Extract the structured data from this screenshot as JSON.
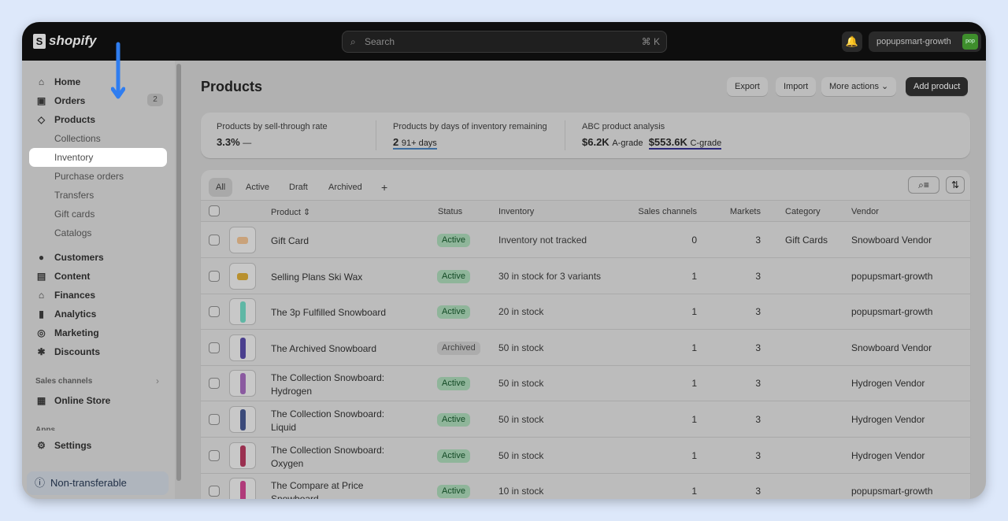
{
  "topbar": {
    "logo": "shopify",
    "search_placeholder": "Search",
    "search_shortcut": "⌘ K",
    "store_name": "popupsmart-growth",
    "avatar": "pop"
  },
  "sidebar": {
    "items": [
      {
        "label": "Home",
        "icon": "home-icon"
      },
      {
        "label": "Orders",
        "icon": "inbox-icon",
        "badge": "2"
      },
      {
        "label": "Products",
        "icon": "tag-icon"
      }
    ],
    "product_sub": [
      "Collections",
      "Inventory",
      "Purchase orders",
      "Transfers",
      "Gift cards",
      "Catalogs"
    ],
    "items2": [
      {
        "label": "Customers",
        "icon": "person-icon"
      },
      {
        "label": "Content",
        "icon": "content-icon"
      },
      {
        "label": "Finances",
        "icon": "bank-icon"
      },
      {
        "label": "Analytics",
        "icon": "chart-icon"
      },
      {
        "label": "Marketing",
        "icon": "target-icon"
      },
      {
        "label": "Discounts",
        "icon": "discount-icon"
      }
    ],
    "sales_channels_label": "Sales channels",
    "online_store": "Online Store",
    "apps_label": "Apps",
    "settings": "Settings",
    "non_transferable": "Non-transferable"
  },
  "page": {
    "title": "Products",
    "export": "Export",
    "import": "Import",
    "more_actions": "More actions",
    "add_product": "Add product"
  },
  "metrics": {
    "m1": {
      "title": "Products by sell-through rate",
      "value": "3.3%",
      "trend": "—"
    },
    "m2": {
      "title": "Products by days of inventory remaining",
      "value": "2",
      "suffix": "91+ days"
    },
    "m3": {
      "title": "ABC product analysis",
      "a_value": "$6.2K",
      "a_label": "A-grade",
      "c_value": "$553.6K",
      "c_label": "C-grade"
    }
  },
  "tabs": [
    "All",
    "Active",
    "Draft",
    "Archived",
    "+"
  ],
  "columns": {
    "product": "Product",
    "status": "Status",
    "inventory": "Inventory",
    "sales_channels": "Sales channels",
    "markets": "Markets",
    "category": "Category",
    "vendor": "Vendor"
  },
  "rows": [
    {
      "name": "Gift Card",
      "name2": "",
      "status": "Active",
      "inventory": "Inventory not tracked",
      "channels": "0",
      "markets": "3",
      "category": "Gift Cards",
      "vendor": "Snowboard Vendor"
    },
    {
      "name": "Selling Plans Ski Wax",
      "name2": "",
      "status": "Active",
      "inventory": "30 in stock for 3 variants",
      "channels": "1",
      "markets": "3",
      "category": "",
      "vendor": "popupsmart-growth"
    },
    {
      "name": "The 3p Fulfilled Snowboard",
      "name2": "",
      "status": "Active",
      "inventory": "20 in stock",
      "channels": "1",
      "markets": "3",
      "category": "",
      "vendor": "popupsmart-growth"
    },
    {
      "name": "The Archived Snowboard",
      "name2": "",
      "status": "Archived",
      "inventory": "50 in stock",
      "channels": "1",
      "markets": "3",
      "category": "",
      "vendor": "Snowboard Vendor"
    },
    {
      "name": "The Collection Snowboard:",
      "name2": "Hydrogen",
      "status": "Active",
      "inventory": "50 in stock",
      "channels": "1",
      "markets": "3",
      "category": "",
      "vendor": "Hydrogen Vendor"
    },
    {
      "name": "The Collection Snowboard:",
      "name2": "Liquid",
      "status": "Active",
      "inventory": "50 in stock",
      "channels": "1",
      "markets": "3",
      "category": "",
      "vendor": "Hydrogen Vendor"
    },
    {
      "name": "The Collection Snowboard:",
      "name2": "Oxygen",
      "status": "Active",
      "inventory": "50 in stock",
      "channels": "1",
      "markets": "3",
      "category": "",
      "vendor": "Hydrogen Vendor"
    },
    {
      "name": "The Compare at Price",
      "name2": "Snowboard",
      "status": "Active",
      "inventory": "10 in stock",
      "channels": "1",
      "markets": "3",
      "category": "",
      "vendor": "popupsmart-growth"
    }
  ],
  "thumb_colors": [
    "#c9a27a",
    "#b8902e",
    "#5fb7a5",
    "#4a3f8e",
    "#8a5aa0",
    "#3b4a7a",
    "#9a3050",
    "#b03a7a"
  ],
  "arrow_color": "#2f7df0"
}
